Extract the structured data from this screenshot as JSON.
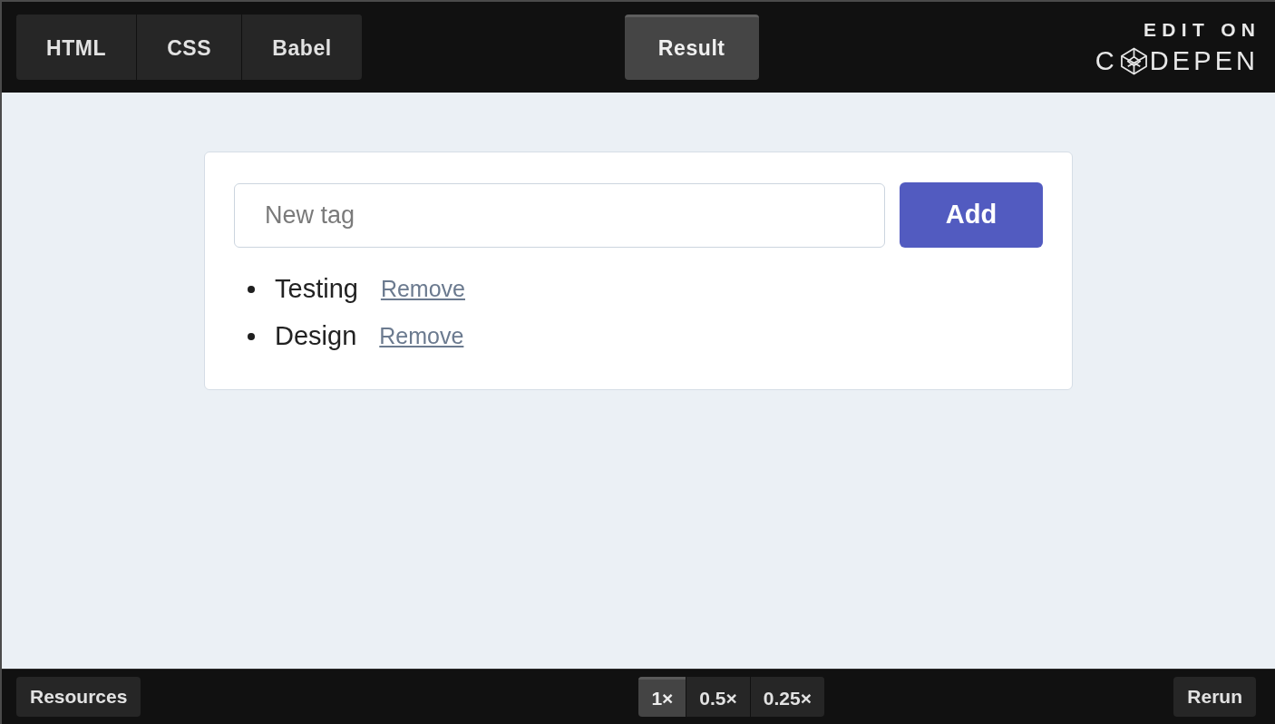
{
  "editor_tabs": [
    {
      "label": "HTML",
      "selected": false
    },
    {
      "label": "CSS",
      "selected": false
    },
    {
      "label": "Babel",
      "selected": false
    }
  ],
  "result_tab": {
    "label": "Result",
    "selected": true
  },
  "logo": {
    "line_1": "EDIT ON",
    "name_start": "C",
    "name_end": "DEPEN"
  },
  "tag_form": {
    "input": {
      "placeholder": "New tag"
    },
    "add_button": "Add"
  },
  "tags": [
    {
      "name": "Testing",
      "action": "Remove"
    },
    {
      "name": "Design",
      "action": "Remove"
    }
  ],
  "footer": {
    "resources_button": "Resources",
    "zoom_options": [
      {
        "label": "1×",
        "selected": true
      },
      {
        "label": "0.5×",
        "selected": false
      },
      {
        "label": "0.25×",
        "selected": false
      }
    ],
    "rerun_button": "Rerun"
  }
}
